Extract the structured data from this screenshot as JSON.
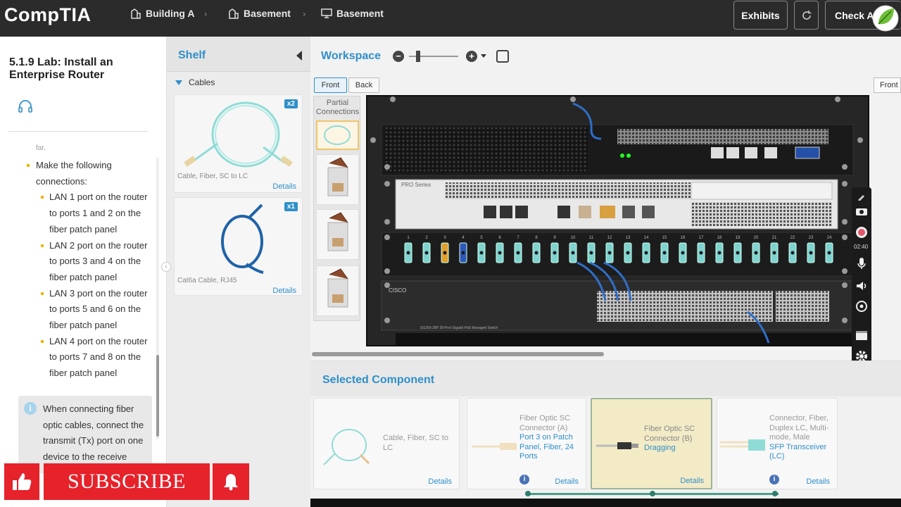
{
  "header": {
    "logo": "CompTIA",
    "breadcrumbs": [
      "Building A",
      "Basement",
      "Basement"
    ],
    "exhibits_label": "Exhibits",
    "check_label": "Check Ans"
  },
  "lab": {
    "title": "5.1.9 Lab: Install an Enterprise Router",
    "cut_text": "far.",
    "instruction_main": "Make the following connections:",
    "steps": [
      "LAN 1 port on the router to ports 1 and 2 on the fiber patch panel",
      "LAN 2 port on the router to ports 3 and 4 on the fiber patch panel",
      "LAN 3 port on the router to ports 5 and 6 on the fiber patch panel",
      "LAN 4 port on the router to ports 7 and 8 on the fiber patch panel"
    ],
    "info_text": "When connecting fiber optic cables, connect the transmit (Tx) port on one device to the receive (Rx) p..."
  },
  "shelf": {
    "title": "Shelf",
    "group": "Cables",
    "items": [
      {
        "label": "Cable, Fiber, SC to LC",
        "count": "x2",
        "details": "Details"
      },
      {
        "label": "Cat6a Cable, RJ45",
        "count": "x1",
        "details": "Details"
      }
    ]
  },
  "workspace": {
    "title": "Workspace",
    "front_label": "Front",
    "back_label": "Back",
    "partial_label": "Partial Connections",
    "right_front_label": "Front",
    "patch_port_numbers": [
      "1",
      "2",
      "3",
      "4",
      "5",
      "6",
      "7",
      "8",
      "9",
      "10",
      "11",
      "12",
      "13",
      "14",
      "15",
      "16",
      "17",
      "18",
      "19",
      "20",
      "21",
      "22",
      "23",
      "24"
    ],
    "switch_model": "SG300-28P 28-Port Gigabit PoE Managed Switch",
    "router_brand": "PRO Series",
    "switch_brand": "CISCO",
    "timer": "02:40"
  },
  "selected": {
    "title": "Selected Component",
    "cards": [
      {
        "name": "Cable, Fiber, SC to LC",
        "details": "Details"
      },
      {
        "name": "Fiber Optic SC Connector (A)",
        "status": "Port 3 on Patch Panel, Fiber, 24 Ports",
        "details": "Details"
      },
      {
        "name": "Fiber Optic SC Connector (B)",
        "status": "Dragging",
        "details": "Details"
      },
      {
        "name": "Connector, Fiber, Duplex LC, Multi-mode, Male",
        "status": "SFP Transceiver (LC)",
        "details": "Details"
      }
    ]
  },
  "overlay": {
    "subscribe": "SUBSCRIBE"
  },
  "colors": {
    "accent": "#2f8fc9",
    "topbar": "#2b2b2b",
    "subscribe_red": "#e6222b",
    "fiber_aqua": "#7fd3cf"
  }
}
